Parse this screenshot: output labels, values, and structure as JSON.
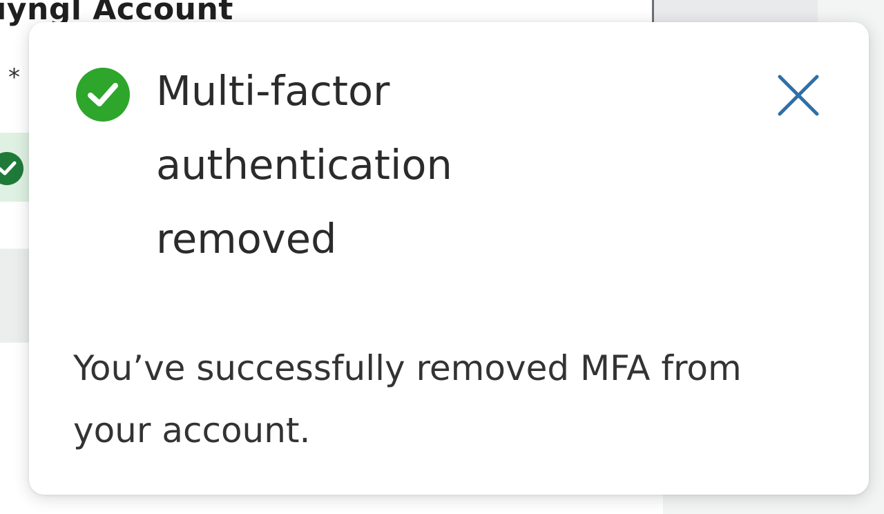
{
  "background": {
    "heading_fragment": "uyngl Account",
    "required_marker": "*"
  },
  "toast": {
    "status": "success",
    "icon": "check-circle-icon",
    "title": "Multi-factor authentication removed",
    "message": "You’ve successfully removed MFA from your account.",
    "close_icon": "close-icon",
    "colors": {
      "success": "#2ea52b",
      "close": "#2f6fa8",
      "title_text": "#2b2b2b"
    }
  }
}
